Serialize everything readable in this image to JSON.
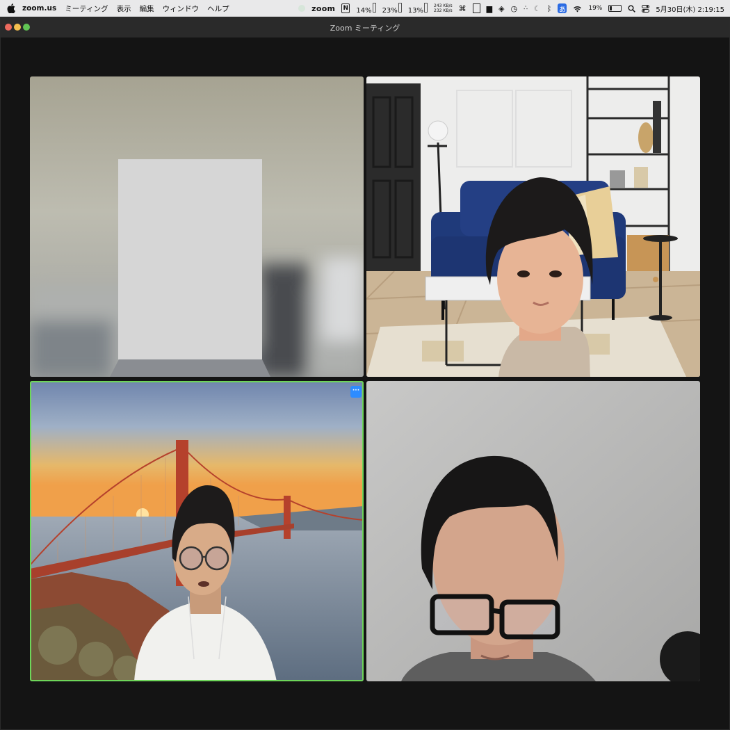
{
  "menubar": {
    "apple_icon": "apple-logo",
    "app_name": "zoom.us",
    "menus": [
      "ミーティング",
      "表示",
      "編集",
      "ウィンドウ",
      "ヘルプ"
    ],
    "status": {
      "zoom_label": "zoom",
      "n_icon": "N",
      "cpu1": "14%",
      "cpu2": "23%",
      "cpu3": "13%",
      "net_up": "243 KB/s",
      "net_down": "232 KB/s",
      "battery": "19%",
      "ime": "あ",
      "datetime": "5月30日(木) 2:19:15"
    }
  },
  "window": {
    "title": "Zoom ミーティング"
  },
  "tiles": [
    {
      "name": "participant-1",
      "content": "blurred-video-redacted"
    },
    {
      "name": "participant-2",
      "content": "living-room-virtual-background"
    },
    {
      "name": "participant-3",
      "content": "golden-gate-virtual-background",
      "active_speaker": true,
      "more_label": "···"
    },
    {
      "name": "participant-4",
      "content": "plain-wall"
    }
  ],
  "colors": {
    "active_border": "#6ed65a",
    "zoom_blue": "#2d8cff"
  }
}
